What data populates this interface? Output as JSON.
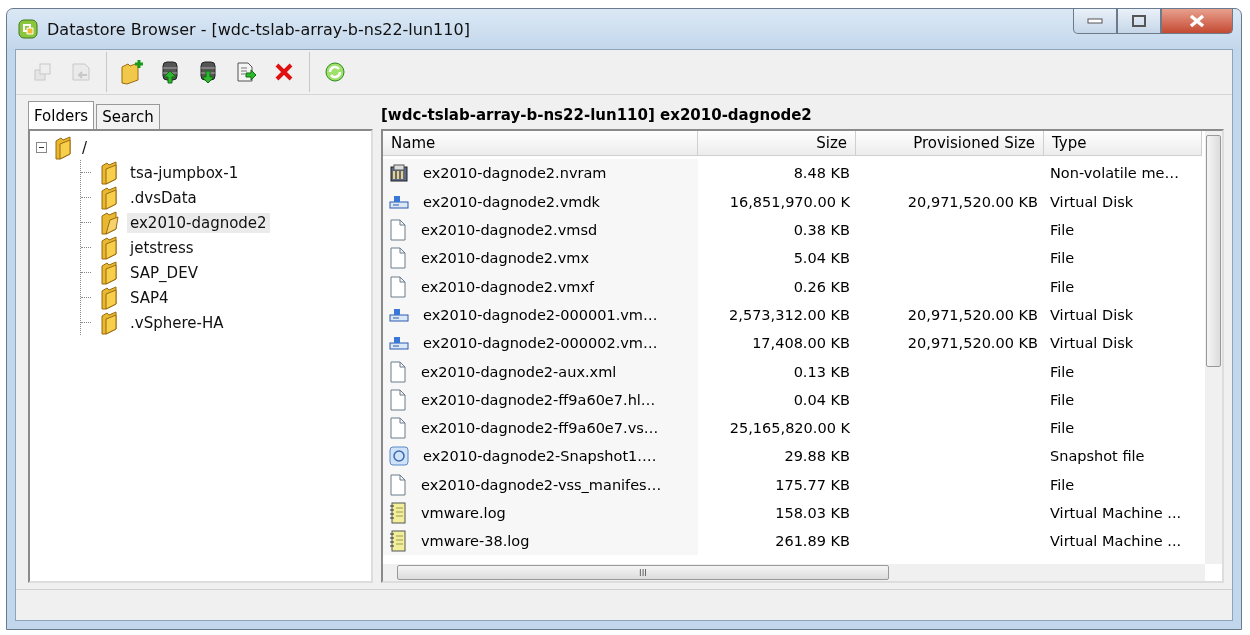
{
  "window": {
    "title": "Datastore Browser - [wdc-tslab-array-b-ns22-lun110]"
  },
  "toolbar": [
    {
      "kind": "copy",
      "disabled": true
    },
    {
      "kind": "move",
      "disabled": true
    },
    {
      "separator_before": true,
      "kind": "new-folder",
      "disabled": false
    },
    {
      "kind": "upload",
      "disabled": false
    },
    {
      "kind": "download",
      "disabled": false
    },
    {
      "kind": "register",
      "disabled": false
    },
    {
      "kind": "delete",
      "disabled": false
    },
    {
      "separator_before": true,
      "kind": "refresh",
      "disabled": false
    }
  ],
  "tabs": [
    {
      "label": "Folders",
      "selected": true
    },
    {
      "label": "Search",
      "selected": false
    }
  ],
  "tree": {
    "label": "/",
    "expanded": true,
    "selected": false,
    "children": [
      {
        "label": "tsa-jumpbox-1",
        "selected": false
      },
      {
        "label": ".dvsData",
        "selected": false
      },
      {
        "label": "ex2010-dagnode2",
        "selected": true
      },
      {
        "label": "jetstress",
        "selected": false
      },
      {
        "label": "SAP_DEV",
        "selected": false
      },
      {
        "label": "SAP4",
        "selected": false
      },
      {
        "label": ".vSphere-HA",
        "selected": false
      }
    ]
  },
  "path": "[wdc-tslab-array-b-ns22-lun110] ex2010-dagnode2",
  "table": {
    "columns": [
      "Name",
      "Size",
      "Provisioned Size",
      "Type"
    ],
    "rows": [
      {
        "kind": "nvram",
        "name": "ex2010-dagnode2.nvram",
        "size": "8.48 KB",
        "provisioned": "",
        "type": "Non-volatile me…"
      },
      {
        "kind": "disk",
        "name": "ex2010-dagnode2.vmdk",
        "size": "16,851,970.00 K",
        "provisioned": "20,971,520.00 KB",
        "type": "Virtual Disk"
      },
      {
        "kind": "file",
        "name": "ex2010-dagnode2.vmsd",
        "size": "0.38 KB",
        "provisioned": "",
        "type": "File"
      },
      {
        "kind": "file",
        "name": "ex2010-dagnode2.vmx",
        "size": "5.04 KB",
        "provisioned": "",
        "type": "File"
      },
      {
        "kind": "file",
        "name": "ex2010-dagnode2.vmxf",
        "size": "0.26 KB",
        "provisioned": "",
        "type": "File"
      },
      {
        "kind": "disk",
        "name": "ex2010-dagnode2-000001.vm…",
        "size": "2,573,312.00 KB",
        "provisioned": "20,971,520.00 KB",
        "type": "Virtual Disk"
      },
      {
        "kind": "disk",
        "name": "ex2010-dagnode2-000002.vm…",
        "size": "17,408.00 KB",
        "provisioned": "20,971,520.00 KB",
        "type": "Virtual Disk"
      },
      {
        "kind": "file",
        "name": "ex2010-dagnode2-aux.xml",
        "size": "0.13 KB",
        "provisioned": "",
        "type": "File"
      },
      {
        "kind": "file",
        "name": "ex2010-dagnode2-ff9a60e7.hl…",
        "size": "0.04 KB",
        "provisioned": "",
        "type": "File"
      },
      {
        "kind": "file",
        "name": "ex2010-dagnode2-ff9a60e7.vs…",
        "size": "25,165,820.00 K",
        "provisioned": "",
        "type": "File"
      },
      {
        "kind": "snapshot",
        "name": "ex2010-dagnode2-Snapshot1.…",
        "size": "29.88 KB",
        "provisioned": "",
        "type": "Snapshot file"
      },
      {
        "kind": "file",
        "name": "ex2010-dagnode2-vss_manifes…",
        "size": "175.77 KB",
        "provisioned": "",
        "type": "File"
      },
      {
        "kind": "log",
        "name": "vmware.log",
        "size": "158.03 KB",
        "provisioned": "",
        "type": "Virtual Machine ..."
      },
      {
        "kind": "log",
        "name": "vmware-38.log",
        "size": "261.89 KB",
        "provisioned": "",
        "type": "Virtual Machine ..."
      }
    ]
  },
  "horizontal_scroll_grip": "III"
}
